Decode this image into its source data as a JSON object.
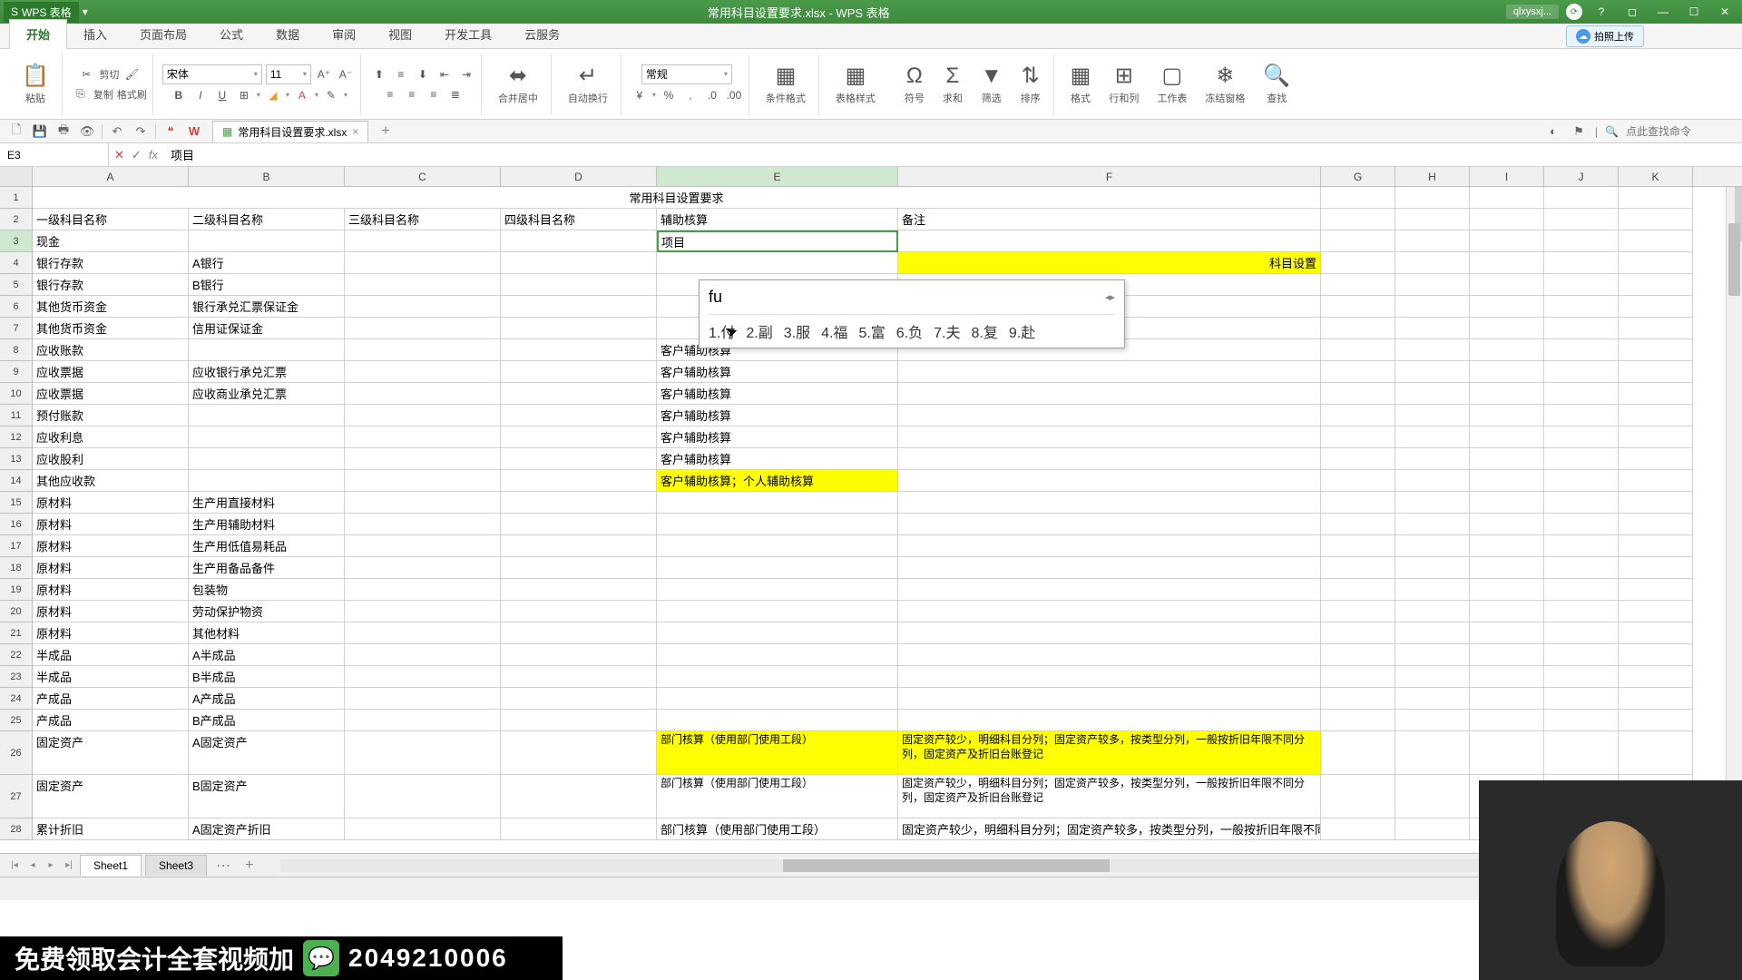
{
  "app": {
    "name": "WPS 表格",
    "doc_title": "常用科目设置要求.xlsx - WPS 表格"
  },
  "user": {
    "name": "qlxysxj..."
  },
  "upload_badge": "拍照上传",
  "menu": {
    "tabs": [
      "开始",
      "插入",
      "页面布局",
      "公式",
      "数据",
      "审阅",
      "视图",
      "开发工具",
      "云服务"
    ],
    "active": 0
  },
  "ribbon": {
    "paste": "粘贴",
    "cut": "剪切",
    "copy": "复制",
    "fmtpaint": "格式刷",
    "font": "宋体",
    "size": "11",
    "merge": "合并居中",
    "wrap": "自动换行",
    "numfmt": "常规",
    "condfmt": "条件格式",
    "tblstyle": "表格样式",
    "symbol": "符号",
    "sum": "求和",
    "filter": "筛选",
    "sort": "排序",
    "format": "格式",
    "rowcol": "行和列",
    "worksheet": "工作表",
    "freeze": "冻结窗格",
    "find": "查找"
  },
  "qat": {
    "doc_tab": "常用科目设置要求.xlsx",
    "search_ph": "点此查找命令"
  },
  "fbar": {
    "ref": "E3",
    "content": "项目"
  },
  "cols": [
    "A",
    "B",
    "C",
    "D",
    "E",
    "F",
    "G",
    "H",
    "I",
    "J",
    "K"
  ],
  "rows": [
    {
      "n": 1,
      "title": "常用科目设置要求"
    },
    {
      "n": 2,
      "A": "一级科目名称",
      "B": "二级科目名称",
      "C": "三级科目名称",
      "D": "四级科目名称",
      "E": "辅助核算",
      "F": "备注"
    },
    {
      "n": 3,
      "A": "现金",
      "E": "项目",
      "editing": true
    },
    {
      "n": 4,
      "A": "银行存款",
      "B": "A银行",
      "F_tail": "科目设置",
      "F_hl": true
    },
    {
      "n": 5,
      "A": "银行存款",
      "B": "B银行"
    },
    {
      "n": 6,
      "A": "其他货币资金",
      "B": "银行承兑汇票保证金"
    },
    {
      "n": 7,
      "A": "其他货币资金",
      "B": "信用证保证金"
    },
    {
      "n": 8,
      "A": "应收账款",
      "E": "客户辅助核算"
    },
    {
      "n": 9,
      "A": "应收票据",
      "B": "应收银行承兑汇票",
      "E": "客户辅助核算"
    },
    {
      "n": 10,
      "A": "应收票据",
      "B": "应收商业承兑汇票",
      "E": "客户辅助核算"
    },
    {
      "n": 11,
      "A": "预付账款",
      "E": "客户辅助核算"
    },
    {
      "n": 12,
      "A": "应收利息",
      "E": "客户辅助核算"
    },
    {
      "n": 13,
      "A": "应收股利",
      "E": "客户辅助核算"
    },
    {
      "n": 14,
      "A": "其他应收款",
      "E": "客户辅助核算；个人辅助核算",
      "E_hl": true
    },
    {
      "n": 15,
      "A": "原材料",
      "B": "生产用直接材料"
    },
    {
      "n": 16,
      "A": "原材料",
      "B": "生产用辅助材料"
    },
    {
      "n": 17,
      "A": "原材料",
      "B": "生产用低值易耗品"
    },
    {
      "n": 18,
      "A": "原材料",
      "B": "生产用备品备件"
    },
    {
      "n": 19,
      "A": "原材料",
      "B": "包装物"
    },
    {
      "n": 20,
      "A": "原材料",
      "B": "劳动保护物资"
    },
    {
      "n": 21,
      "A": "原材料",
      "B": "其他材料"
    },
    {
      "n": 22,
      "A": "半成品",
      "B": "A半成品"
    },
    {
      "n": 23,
      "A": "半成品",
      "B": "B半成品"
    },
    {
      "n": 24,
      "A": "产成品",
      "B": "A产成品"
    },
    {
      "n": 25,
      "A": "产成品",
      "B": "B产成品"
    },
    {
      "n": 26,
      "A": "固定资产",
      "B": "A固定资产",
      "E": "部门核算（使用部门使用工段）",
      "E_hl": true,
      "F": "固定资产较少，明细科目分列；固定资产较多，按类型分列，一般按折旧年限不同分列，固定资产及折旧台账登记",
      "F_hl": true,
      "tall": true
    },
    {
      "n": 27,
      "A": "固定资产",
      "B": "B固定资产",
      "E": "部门核算（使用部门使用工段）",
      "F": "固定资产较少，明细科目分列；固定资产较多，按类型分列，一般按折旧年限不同分列，固定资产及折旧台账登记",
      "tall": true
    },
    {
      "n": 28,
      "A": "累计折旧",
      "B": "A固定资产折旧",
      "E": "部门核算（使用部门使用工段）",
      "F": "固定资产较少，明细科目分列；固定资产较多，按类型分列，一般按折旧年限不同分列，固定资产及折旧台账登记"
    }
  ],
  "ime": {
    "input": "fu",
    "candidates": [
      "1.付",
      "2.副",
      "3.服",
      "4.福",
      "5.富",
      "6.负",
      "7.夫",
      "8.复",
      "9.赴"
    ]
  },
  "sheets": {
    "active": "Sheet1",
    "tabs": [
      "Sheet1",
      "Sheet3"
    ]
  },
  "banner": {
    "text": "免费领取会计全套视频加",
    "number": "2049210006"
  }
}
